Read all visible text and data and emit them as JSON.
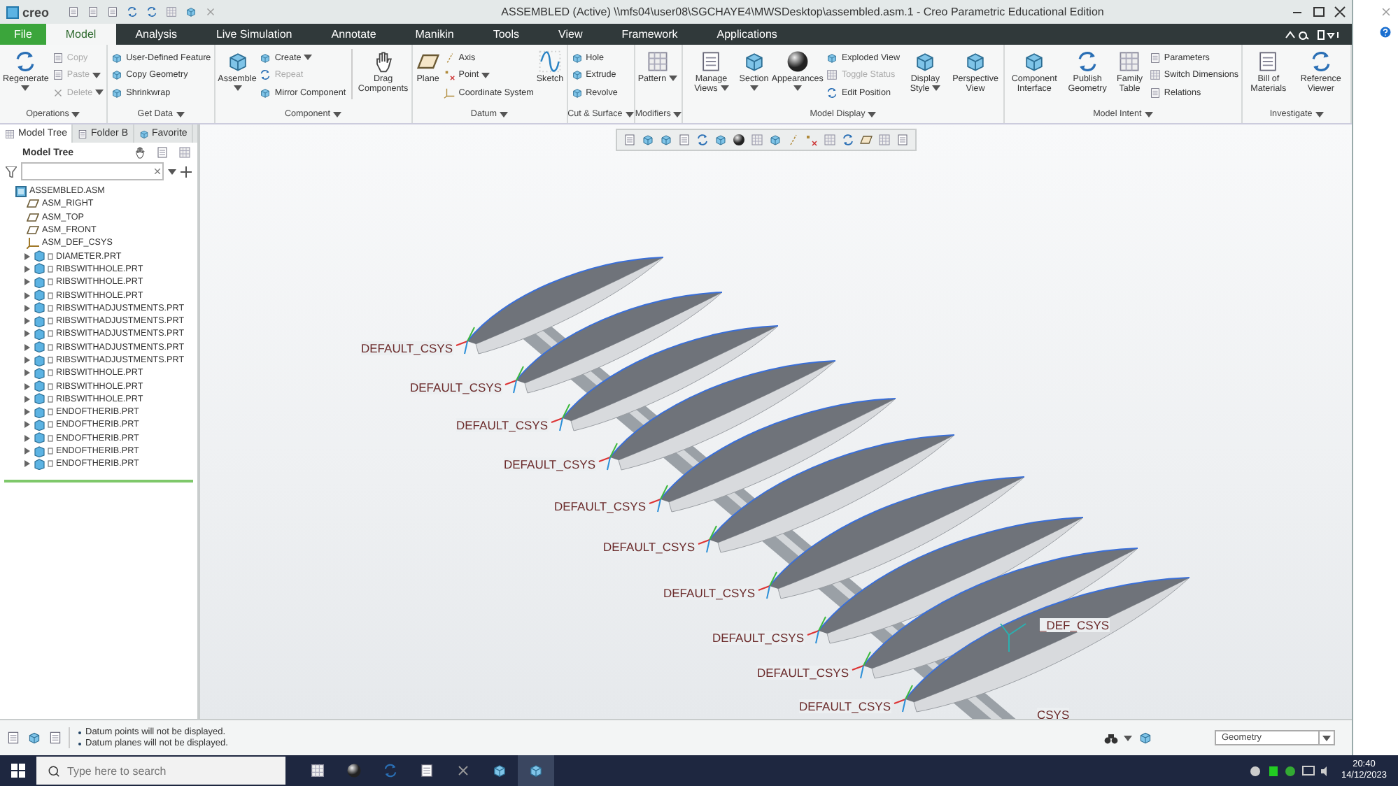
{
  "title_bar": {
    "logo": "creo",
    "title": "ASSEMBLED (Active) \\\\mfs04\\user08\\SGCHAYE4\\MWSDesktop\\assembled.asm.1 - Creo Parametric Educational Edition"
  },
  "tabs": [
    {
      "label": "File",
      "kind": "file",
      "selected": false
    },
    {
      "label": "Model",
      "kind": "tab",
      "selected": true
    },
    {
      "label": "Analysis",
      "kind": "tab",
      "selected": false
    },
    {
      "label": "Live Simulation",
      "kind": "tab",
      "selected": false
    },
    {
      "label": "Annotate",
      "kind": "tab",
      "selected": false
    },
    {
      "label": "Manikin",
      "kind": "tab",
      "selected": false
    },
    {
      "label": "Tools",
      "kind": "tab",
      "selected": false
    },
    {
      "label": "View",
      "kind": "tab",
      "selected": false
    },
    {
      "label": "Framework",
      "kind": "tab",
      "selected": false
    },
    {
      "label": "Applications",
      "kind": "tab",
      "selected": false
    }
  ],
  "ribbon": {
    "groups": [
      {
        "label": "Operations",
        "dropdown": true,
        "items": [
          {
            "kind": "large",
            "label": "Regenerate",
            "dropdown": true,
            "disabled": false
          },
          {
            "kind": "column",
            "items": [
              {
                "label": "Copy",
                "dropdown": false,
                "disabled": true
              },
              {
                "label": "Paste",
                "dropdown": true,
                "disabled": true
              },
              {
                "label": "Delete",
                "dropdown": true,
                "disabled": true
              }
            ]
          }
        ]
      },
      {
        "label": "Get Data",
        "dropdown": true,
        "items": [
          {
            "kind": "column",
            "items": [
              {
                "label": "User-Defined Feature",
                "dropdown": false,
                "disabled": false
              },
              {
                "label": "Copy Geometry",
                "dropdown": false,
                "disabled": false
              },
              {
                "label": "Shrinkwrap",
                "dropdown": false,
                "disabled": false
              }
            ]
          }
        ]
      },
      {
        "label": "Component",
        "dropdown": true,
        "items": [
          {
            "kind": "large",
            "label": "Assemble",
            "dropdown": true,
            "disabled": false
          },
          {
            "kind": "column",
            "items": [
              {
                "label": "Create",
                "dropdown": true,
                "disabled": false
              },
              {
                "label": "Repeat",
                "dropdown": false,
                "disabled": true
              },
              {
                "label": "Mirror Component",
                "dropdown": false,
                "disabled": false
              }
            ]
          },
          {
            "kind": "separator"
          },
          {
            "kind": "large",
            "label": "Drag Components",
            "dropdown": false,
            "disabled": false
          }
        ]
      },
      {
        "label": "Datum",
        "dropdown": true,
        "items": [
          {
            "kind": "large",
            "label": "Plane",
            "dropdown": false,
            "disabled": false
          },
          {
            "kind": "column",
            "items": [
              {
                "label": "Axis",
                "dropdown": false,
                "disabled": false
              },
              {
                "label": "Point",
                "dropdown": true,
                "disabled": false
              },
              {
                "label": "Coordinate System",
                "dropdown": false,
                "disabled": false
              }
            ]
          },
          {
            "kind": "large",
            "label": "Sketch",
            "dropdown": false,
            "disabled": false
          }
        ]
      },
      {
        "label": "Cut & Surface",
        "dropdown": true,
        "items": [
          {
            "kind": "column",
            "items": [
              {
                "label": "Hole",
                "dropdown": false,
                "disabled": false
              },
              {
                "label": "Extrude",
                "dropdown": false,
                "disabled": false
              },
              {
                "label": "Revolve",
                "dropdown": false,
                "disabled": false
              }
            ]
          }
        ]
      },
      {
        "label": "Modifiers",
        "dropdown": true,
        "items": [
          {
            "kind": "large",
            "label": "Pattern",
            "dropdown": true,
            "disabled": false
          }
        ]
      },
      {
        "label": "Model Display",
        "dropdown": true,
        "items": [
          {
            "kind": "large",
            "label": "Manage Views",
            "dropdown": true,
            "disabled": false
          },
          {
            "kind": "large",
            "label": "Section",
            "dropdown": true,
            "disabled": false
          },
          {
            "kind": "large",
            "label": "Appearances",
            "dropdown": true,
            "disabled": false
          },
          {
            "kind": "column",
            "items": [
              {
                "label": "Exploded View",
                "dropdown": false,
                "disabled": false
              },
              {
                "label": "Toggle Status",
                "dropdown": false,
                "disabled": true
              },
              {
                "label": "Edit Position",
                "dropdown": false,
                "disabled": false
              }
            ]
          },
          {
            "kind": "large",
            "label": "Display Style",
            "dropdown": true,
            "disabled": false
          },
          {
            "kind": "large",
            "label": "Perspective View",
            "dropdown": false,
            "disabled": false
          }
        ]
      },
      {
        "label": "Model Intent",
        "dropdown": true,
        "items": [
          {
            "kind": "large",
            "label": "Component Interface",
            "dropdown": false,
            "disabled": false
          },
          {
            "kind": "large",
            "label": "Publish Geometry",
            "dropdown": false,
            "disabled": false
          },
          {
            "kind": "large",
            "label": "Family Table",
            "dropdown": false,
            "disabled": false
          },
          {
            "kind": "column",
            "items": [
              {
                "label": "Parameters",
                "dropdown": false,
                "disabled": false
              },
              {
                "label": "Switch Dimensions",
                "dropdown": false,
                "disabled": false
              },
              {
                "label": "Relations",
                "dropdown": false,
                "disabled": false
              }
            ]
          }
        ]
      },
      {
        "label": "Investigate",
        "dropdown": true,
        "items": [
          {
            "kind": "large",
            "label": "Bill of Materials",
            "dropdown": false,
            "disabled": false
          },
          {
            "kind": "large",
            "label": "Reference Viewer",
            "dropdown": false,
            "disabled": false
          }
        ]
      }
    ]
  },
  "panel_tabs": [
    {
      "label": "Model Tree",
      "selected": true
    },
    {
      "label": "Folder B",
      "selected": false
    },
    {
      "label": "Favorite",
      "selected": false
    }
  ],
  "model_tree": {
    "title": "Model Tree",
    "root": {
      "label": "ASSEMBLED.ASM",
      "kind": "assembly",
      "children": [
        {
          "label": "ASM_RIGHT",
          "kind": "datum_plane"
        },
        {
          "label": "ASM_TOP",
          "kind": "datum_plane"
        },
        {
          "label": "ASM_FRONT",
          "kind": "datum_plane"
        },
        {
          "label": "ASM_DEF_CSYS",
          "kind": "csys"
        },
        {
          "label": "DIAMETER.PRT",
          "kind": "part",
          "expanded": false
        },
        {
          "label": "RIBSWITHHOLE.PRT",
          "kind": "part",
          "expanded": false
        },
        {
          "label": "RIBSWITHHOLE.PRT",
          "kind": "part",
          "expanded": false
        },
        {
          "label": "RIBSWITHHOLE.PRT",
          "kind": "part",
          "expanded": false
        },
        {
          "label": "RIBSWITHADJUSTMENTS.PRT",
          "kind": "part",
          "expanded": false
        },
        {
          "label": "RIBSWITHADJUSTMENTS.PRT",
          "kind": "part",
          "expanded": false
        },
        {
          "label": "RIBSWITHADJUSTMENTS.PRT",
          "kind": "part",
          "expanded": false
        },
        {
          "label": "RIBSWITHADJUSTMENTS.PRT",
          "kind": "part",
          "expanded": false
        },
        {
          "label": "RIBSWITHADJUSTMENTS.PRT",
          "kind": "part",
          "expanded": false
        },
        {
          "label": "RIBSWITHHOLE.PRT",
          "kind": "part",
          "expanded": false
        },
        {
          "label": "RIBSWITHHOLE.PRT",
          "kind": "part",
          "expanded": false
        },
        {
          "label": "RIBSWITHHOLE.PRT",
          "kind": "part",
          "expanded": false
        },
        {
          "label": "ENDOFTHERIB.PRT",
          "kind": "part",
          "expanded": false
        },
        {
          "label": "ENDOFTHERIB.PRT",
          "kind": "part",
          "expanded": false
        },
        {
          "label": "ENDOFTHERIB.PRT",
          "kind": "part",
          "expanded": false
        },
        {
          "label": "ENDOFTHERIB.PRT",
          "kind": "part",
          "expanded": false
        },
        {
          "label": "ENDOFTHERIB.PRT",
          "kind": "part",
          "expanded": false
        }
      ]
    }
  },
  "graphics": {
    "csys_labels": [
      "DEFAULT_CSYS",
      "DEFAULT_CSYS",
      "DEFAULT_CSYS",
      "DEFAULT_CSYS",
      "DEFAULT_CSYS",
      "DEFAULT_CSYS",
      "DEFAULT_CSYS",
      "DEFAULT_CSYS",
      "DEFAULT_CSYS",
      "DEFAULT_CSYS",
      "_DEF_CSYS",
      "CSYS"
    ]
  },
  "status_bar": {
    "messages": [
      "Datum points will not be displayed.",
      "Datum planes will not be displayed."
    ],
    "filter": "Geometry"
  },
  "taskbar": {
    "search": {
      "placeholder": "Type here to search"
    },
    "time": "20:40",
    "date": "14/12/2023"
  }
}
